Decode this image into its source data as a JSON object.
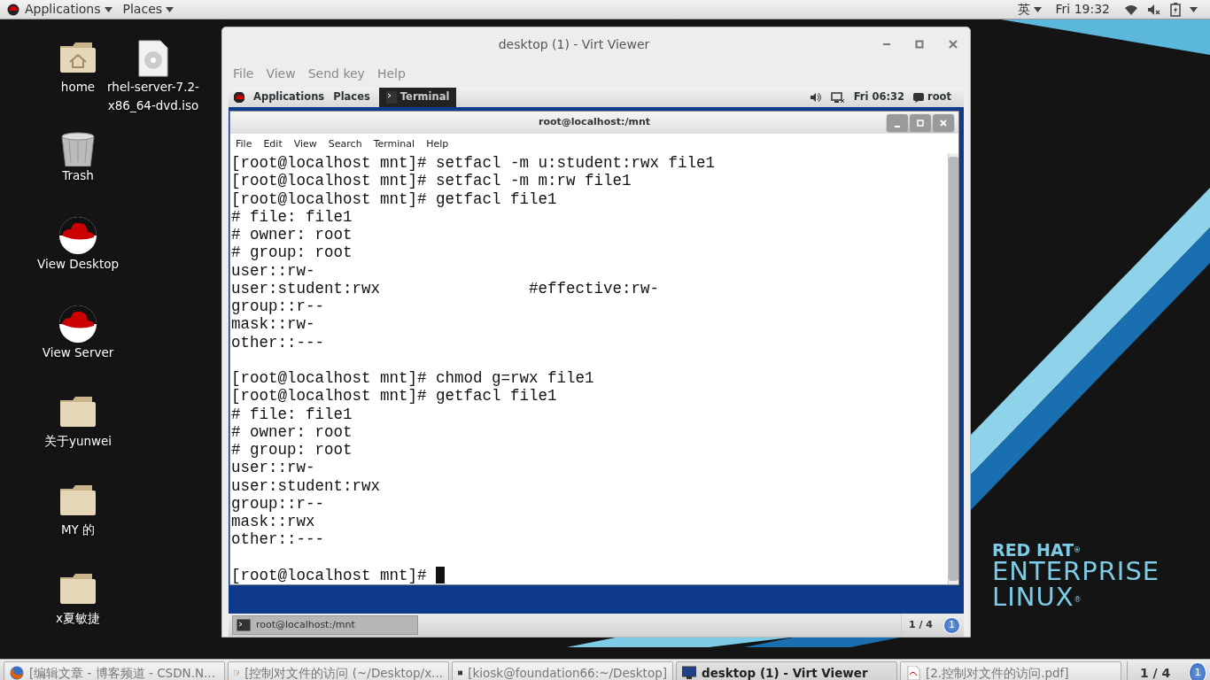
{
  "top_bar": {
    "menus": [
      "Applications",
      "Places"
    ],
    "input_method": "英",
    "clock": "Fri 19:32"
  },
  "desktop_icons": [
    {
      "label": "home",
      "kind": "home"
    },
    {
      "label": "rhel-server-7.2-x86_64-dvd.iso",
      "kind": "disc"
    },
    {
      "label": "Trash",
      "kind": "trash"
    },
    {
      "label": "View Desktop",
      "kind": "hat"
    },
    {
      "label": "View Server",
      "kind": "hat"
    },
    {
      "label": "关于yunwei",
      "kind": "folder"
    },
    {
      "label": "MY 的",
      "kind": "folder"
    },
    {
      "label": "x夏敏捷",
      "kind": "folder"
    }
  ],
  "virt_viewer": {
    "title": "desktop (1) - Virt Viewer",
    "menus": [
      "File",
      "View",
      "Send key",
      "Help"
    ],
    "guest": {
      "top_bar": {
        "menus": [
          "Applications",
          "Places"
        ],
        "task": "Terminal",
        "clock": "Fri 06:32",
        "user": "root"
      },
      "terminal": {
        "title": "root@localhost:/mnt",
        "menus": [
          "File",
          "Edit",
          "View",
          "Search",
          "Terminal",
          "Help"
        ],
        "cursor": true,
        "blocks": [
          [
            "[root@localhost mnt]# setfacl -m u:student:rwx file1",
            "[root@localhost mnt]# setfacl -m m:rw file1",
            "[root@localhost mnt]# getfacl file1",
            "# file: file1",
            "# owner: root",
            "# group: root",
            "user::rw-",
            "user:student:rwx                #effective:rw-",
            "group::r--",
            "mask::rw-",
            "other::---"
          ],
          [
            "[root@localhost mnt]# chmod g=rwx file1",
            "[root@localhost mnt]# getfacl file1",
            "# file: file1",
            "# owner: root",
            "# group: root",
            "user::rw-",
            "user:student:rwx",
            "group::r--",
            "mask::rwx",
            "other::---"
          ],
          [
            "[root@localhost mnt]# "
          ]
        ]
      },
      "bottom_bar": {
        "task": "root@localhost:/mnt",
        "workspace": "1 / 4",
        "notifications": "1"
      }
    }
  },
  "wallpaper_logo": [
    "RED HAT$^{®}$",
    "ENTERPRISE",
    "LINUX$^{®}$"
  ],
  "taskbar": {
    "tasks": [
      {
        "label": "[编辑文章 - 博客频道 - CSDN.N...",
        "kind": "browser",
        "selected": false
      },
      {
        "label": "[控制对文件的访问 (~/Desktop/x...",
        "kind": "editor",
        "selected": false
      },
      {
        "label": "[kiosk@foundation66:~/Desktop]",
        "kind": "terminal",
        "selected": false
      },
      {
        "label": "desktop (1) - Virt Viewer",
        "kind": "monitor",
        "selected": true
      },
      {
        "label": "[2.控制对文件的访问.pdf]",
        "kind": "pdf",
        "selected": false
      }
    ],
    "workspace": "1 / 4",
    "notifications": "1"
  }
}
